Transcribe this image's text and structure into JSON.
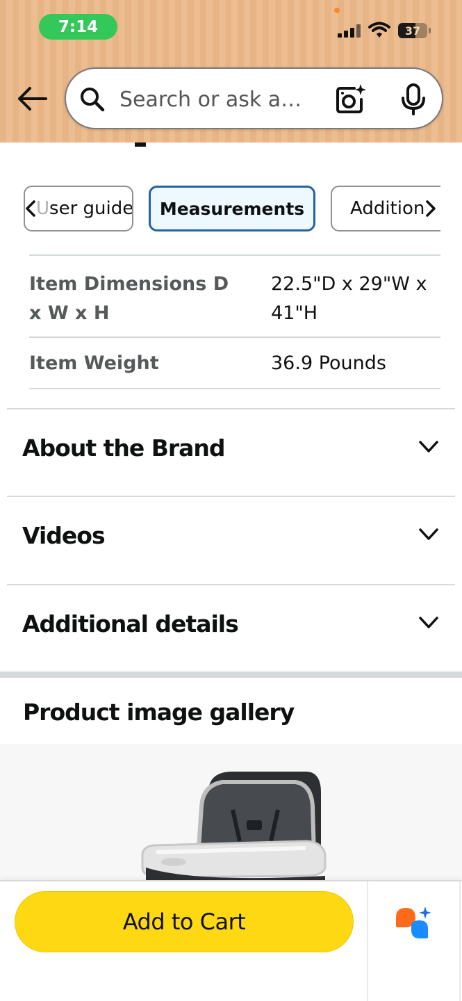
{
  "status_bar": {
    "time": "7:14",
    "battery": "37"
  },
  "search": {
    "placeholder": "Search or ask a…"
  },
  "tabs": [
    {
      "prefix": "U",
      "label": "ser guide"
    },
    {
      "label": "Measurements",
      "selected": true
    },
    {
      "label": "Addition"
    }
  ],
  "specs": [
    {
      "label": "Item Dimensions D x W x H",
      "value": "22.5\"D x 29\"W x 41\"H"
    },
    {
      "label": "Item Weight",
      "value": "36.9 Pounds"
    }
  ],
  "sections": [
    {
      "title": "About the Brand"
    },
    {
      "title": "Videos"
    },
    {
      "title": "Additional details"
    }
  ],
  "gallery": {
    "title": "Product image gallery"
  },
  "cart": {
    "button_label": "Add to Cart"
  },
  "colors": {
    "accent": "#ffd814",
    "selected_tab_border": "#2162a1",
    "time_pill": "#34c759"
  },
  "icons": [
    "back-arrow-icon",
    "search-icon",
    "camera-lens-icon",
    "microphone-icon",
    "chevron-left-icon",
    "chevron-right-icon",
    "chevron-down-icon",
    "rufus-assistant-icon"
  ]
}
